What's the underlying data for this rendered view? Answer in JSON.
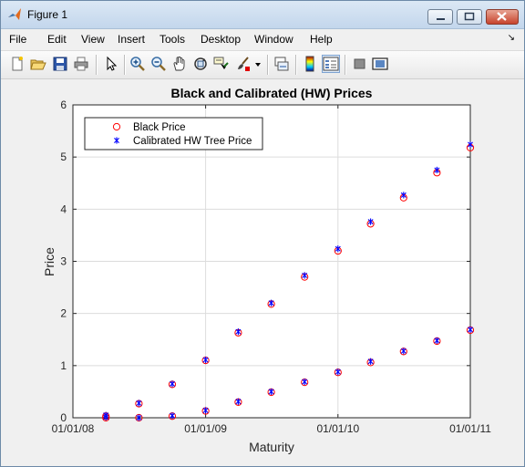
{
  "window": {
    "title": "Figure 1"
  },
  "menubar": {
    "items": [
      "File",
      "Edit",
      "View",
      "Insert",
      "Tools",
      "Desktop",
      "Window",
      "Help"
    ],
    "dock_arrow": "↘"
  },
  "toolbar": {
    "icons": [
      "new-figure-icon",
      "open-file-icon",
      "save-icon",
      "print-icon",
      "edit-plot-arrow-icon",
      "zoom-in-icon",
      "zoom-out-icon",
      "pan-hand-icon",
      "rotate-3d-icon",
      "data-cursor-icon",
      "brush-icon",
      "link-plot-icon",
      "colorbar-icon",
      "legend-icon",
      "hide-plot-tools-icon",
      "show-plot-tools-icon"
    ]
  },
  "chart_data": {
    "type": "scatter",
    "title": "Black and Calibrated (HW) Prices",
    "xlabel": "Maturity",
    "ylabel": "Price",
    "x_ticks": [
      "01/01/08",
      "01/01/09",
      "01/01/10",
      "01/01/11"
    ],
    "y_ticks": [
      "0",
      "1",
      "2",
      "3",
      "4",
      "5",
      "6"
    ],
    "xlim": [
      "01/01/08",
      "01/01/11"
    ],
    "ylim": [
      0,
      6
    ],
    "grid": true,
    "legend_position": "top-left",
    "series": [
      {
        "name": "Black Price",
        "marker": "circle",
        "color": "#ff0000",
        "points": [
          {
            "x": "2008-04-01",
            "y": 0.03
          },
          {
            "x": "2008-07-01",
            "y": 0.27
          },
          {
            "x": "2008-10-01",
            "y": 0.64
          },
          {
            "x": "2009-01-01",
            "y": 1.1
          },
          {
            "x": "2009-04-01",
            "y": 1.63
          },
          {
            "x": "2009-07-01",
            "y": 2.18
          },
          {
            "x": "2009-10-01",
            "y": 2.7
          },
          {
            "x": "2010-01-01",
            "y": 3.2
          },
          {
            "x": "2010-04-01",
            "y": 3.72
          },
          {
            "x": "2010-07-01",
            "y": 4.22
          },
          {
            "x": "2010-10-01",
            "y": 4.7
          },
          {
            "x": "2011-01-01",
            "y": 5.18
          },
          {
            "x": "2008-04-01",
            "y": 0.0
          },
          {
            "x": "2008-07-01",
            "y": 0.0
          },
          {
            "x": "2008-10-01",
            "y": 0.03
          },
          {
            "x": "2009-01-01",
            "y": 0.13
          },
          {
            "x": "2009-04-01",
            "y": 0.3
          },
          {
            "x": "2009-07-01",
            "y": 0.49
          },
          {
            "x": "2009-10-01",
            "y": 0.68
          },
          {
            "x": "2010-01-01",
            "y": 0.87
          },
          {
            "x": "2010-04-01",
            "y": 1.06
          },
          {
            "x": "2010-07-01",
            "y": 1.27
          },
          {
            "x": "2010-10-01",
            "y": 1.47
          },
          {
            "x": "2011-01-01",
            "y": 1.68
          }
        ]
      },
      {
        "name": "Calibrated HW Tree Price",
        "marker": "asterisk",
        "color": "#0000ff",
        "points": [
          {
            "x": "2008-04-01",
            "y": 0.05
          },
          {
            "x": "2008-07-01",
            "y": 0.28
          },
          {
            "x": "2008-10-01",
            "y": 0.65
          },
          {
            "x": "2009-01-01",
            "y": 1.11
          },
          {
            "x": "2009-04-01",
            "y": 1.65
          },
          {
            "x": "2009-07-01",
            "y": 2.2
          },
          {
            "x": "2009-10-01",
            "y": 2.73
          },
          {
            "x": "2010-01-01",
            "y": 3.24
          },
          {
            "x": "2010-04-01",
            "y": 3.76
          },
          {
            "x": "2010-07-01",
            "y": 4.27
          },
          {
            "x": "2010-10-01",
            "y": 4.75
          },
          {
            "x": "2011-01-01",
            "y": 5.24
          },
          {
            "x": "2008-04-01",
            "y": 0.01
          },
          {
            "x": "2008-07-01",
            "y": 0.0
          },
          {
            "x": "2008-10-01",
            "y": 0.04
          },
          {
            "x": "2009-01-01",
            "y": 0.14
          },
          {
            "x": "2009-04-01",
            "y": 0.31
          },
          {
            "x": "2009-07-01",
            "y": 0.5
          },
          {
            "x": "2009-10-01",
            "y": 0.69
          },
          {
            "x": "2010-01-01",
            "y": 0.88
          },
          {
            "x": "2010-04-01",
            "y": 1.08
          },
          {
            "x": "2010-07-01",
            "y": 1.28
          },
          {
            "x": "2010-10-01",
            "y": 1.48
          },
          {
            "x": "2011-01-01",
            "y": 1.69
          }
        ]
      }
    ]
  }
}
